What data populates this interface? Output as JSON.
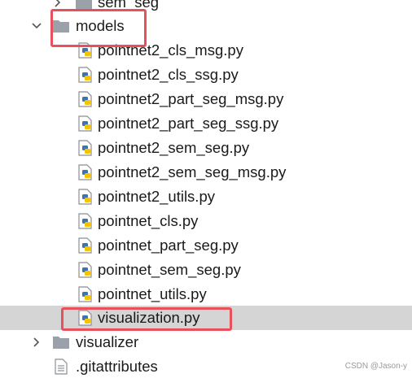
{
  "tree": {
    "partial_folder": {
      "label": "sem_seg"
    },
    "models_folder": {
      "label": "models",
      "expanded": true
    },
    "model_files": [
      {
        "label": "pointnet2_cls_msg.py"
      },
      {
        "label": "pointnet2_cls_ssg.py"
      },
      {
        "label": "pointnet2_part_seg_msg.py"
      },
      {
        "label": "pointnet2_part_seg_ssg.py"
      },
      {
        "label": "pointnet2_sem_seg.py"
      },
      {
        "label": "pointnet2_sem_seg_msg.py"
      },
      {
        "label": "pointnet2_utils.py"
      },
      {
        "label": "pointnet_cls.py"
      },
      {
        "label": "pointnet_part_seg.py"
      },
      {
        "label": "pointnet_sem_seg.py"
      },
      {
        "label": "pointnet_utils.py"
      },
      {
        "label": "visualization.py",
        "selected": true
      }
    ],
    "visualizer_folder": {
      "label": "visualizer",
      "expanded": false
    },
    "gitattributes_file": {
      "label": ".gitattributes"
    }
  },
  "watermark": "CSDN @Jason-y",
  "colors": {
    "selection": "#d5d5d5",
    "annotation_box": "#e8505b",
    "folder": "#9aa1a8",
    "python_blue": "#3a75b0",
    "python_yellow": "#f5c400"
  }
}
